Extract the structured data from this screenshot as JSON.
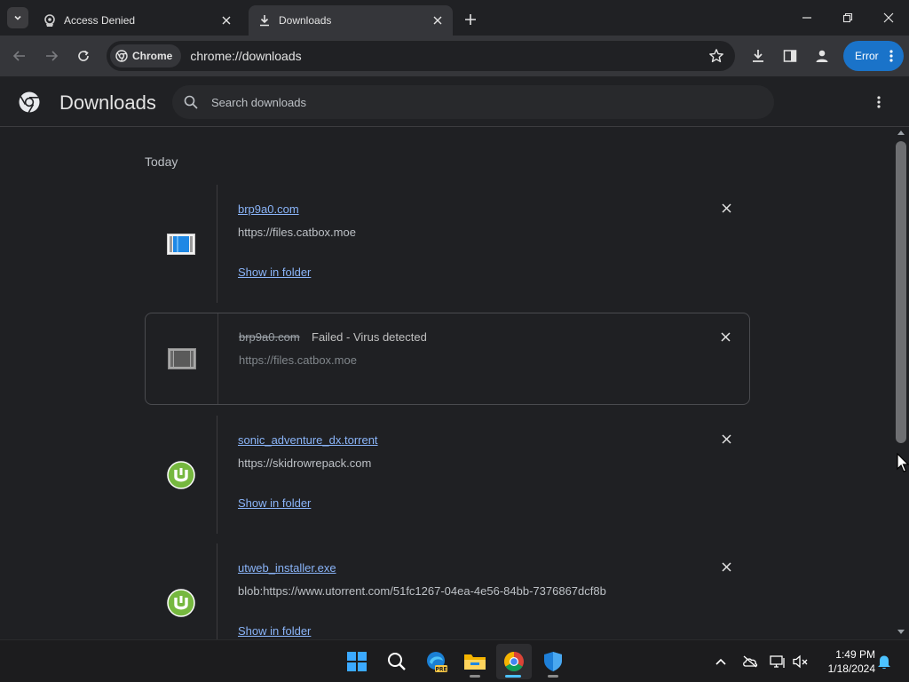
{
  "browser": {
    "tabs": [
      {
        "title": "Access Denied",
        "active": false
      },
      {
        "title": "Downloads",
        "active": true
      }
    ],
    "omnibox": {
      "chip_label": "Chrome",
      "url": "chrome://downloads"
    },
    "profile_error_label": "Error"
  },
  "downloads_page": {
    "title": "Downloads",
    "search_placeholder": "Search downloads",
    "section_label": "Today",
    "items": [
      {
        "name": "brp9a0.com",
        "source": "https://files.catbox.moe",
        "action": "Show in folder",
        "status": "",
        "icon": "file-icon"
      },
      {
        "name": "brp9a0.com",
        "source": "https://files.catbox.moe",
        "action": "",
        "status": "Failed - Virus detected",
        "icon": "file-icon-failed"
      },
      {
        "name": "sonic_adventure_dx.torrent",
        "source": "https://skidrowrepack.com",
        "action": "Show in folder",
        "status": "",
        "icon": "utorrent-icon"
      },
      {
        "name": "utweb_installer.exe",
        "source": "blob:https://www.utorrent.com/51fc1267-04ea-4e56-84bb-7376867dcf8b",
        "action": "Show in folder",
        "status": "",
        "icon": "utorrent-icon"
      }
    ]
  },
  "taskbar": {
    "apps": [
      "start-icon",
      "search-icon",
      "edge-beta-icon",
      "file-explorer-icon",
      "chrome-icon",
      "defender-icon"
    ],
    "clock_time": "1:49 PM",
    "clock_date": "1/18/2024"
  },
  "colors": {
    "accent": "#1a73c9",
    "link": "#8ab4f8",
    "utorrent": "#76b83f"
  }
}
